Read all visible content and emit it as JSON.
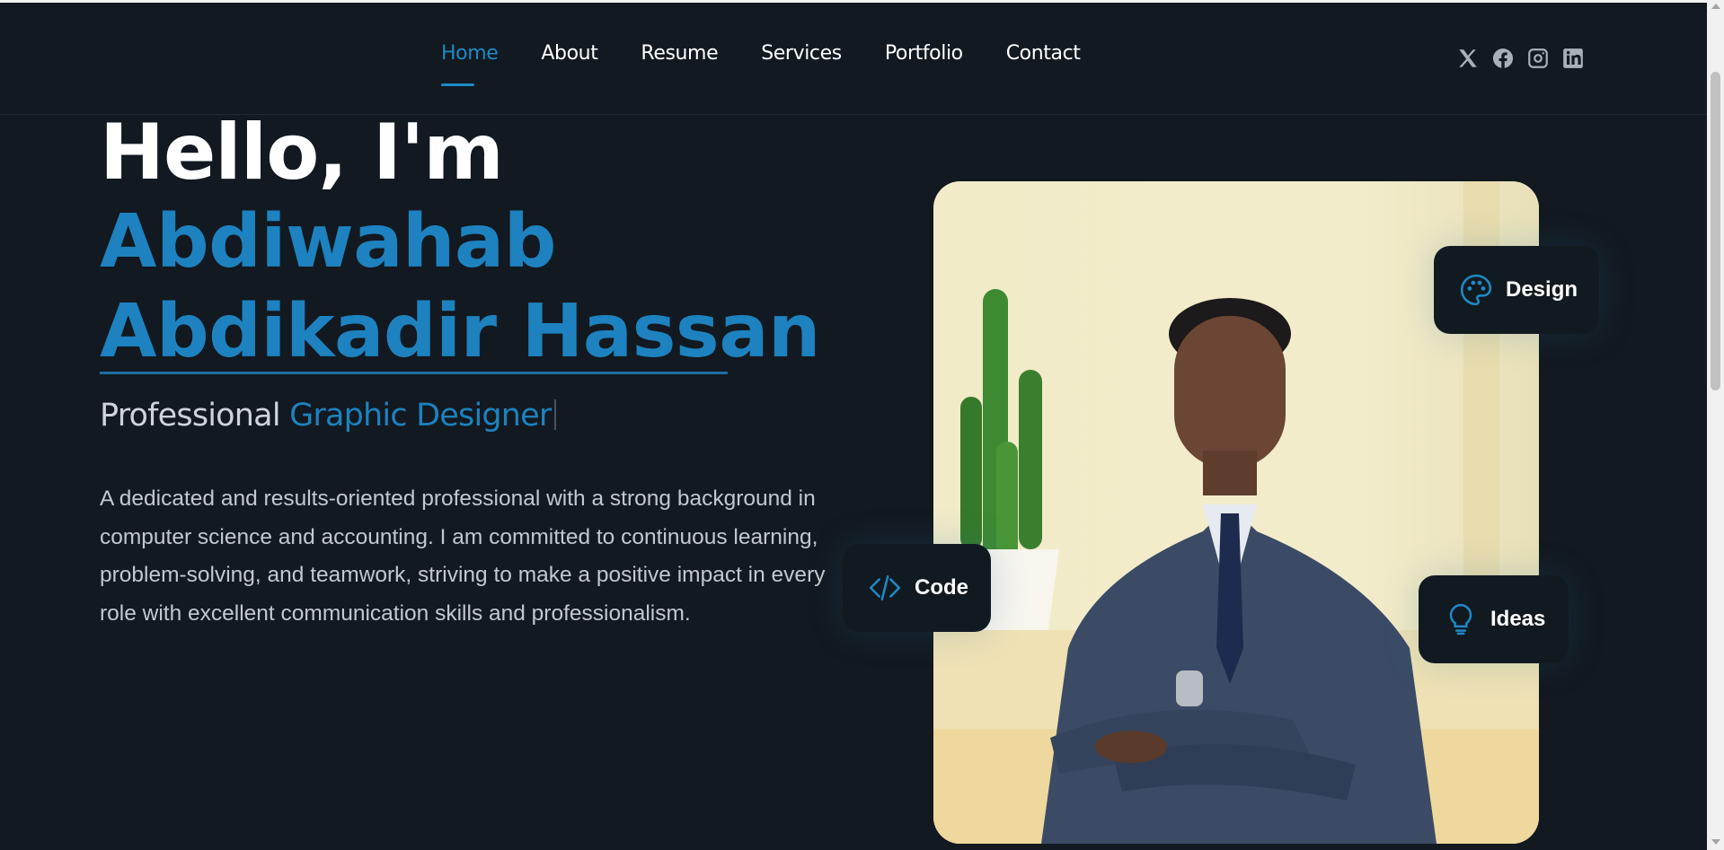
{
  "nav": {
    "items": [
      {
        "label": "Home",
        "active": true
      },
      {
        "label": "About"
      },
      {
        "label": "Resume"
      },
      {
        "label": "Services"
      },
      {
        "label": "Portfolio"
      },
      {
        "label": "Contact"
      }
    ],
    "social": [
      "x-icon",
      "facebook-icon",
      "instagram-icon",
      "linkedin-icon"
    ]
  },
  "hero": {
    "greeting": "Hello, I'm",
    "name_line1": "Abdiwahab",
    "name_line2": "Abdikadir Hassan",
    "role_prefix": "Professional",
    "role_highlight": "Graphic Designer",
    "bio": "A dedicated and results-oriented professional with a strong background in computer science and accounting. I am committed to continuous learning, problem-solving, and teamwork, striving to make a positive impact in every role with excellent communication skills and professionalism."
  },
  "cards": {
    "design": "Design",
    "code": "Code",
    "ideas": "Ideas"
  },
  "colors": {
    "background": "#121920",
    "accent": "#1d82bf",
    "text": "#ffffff"
  }
}
